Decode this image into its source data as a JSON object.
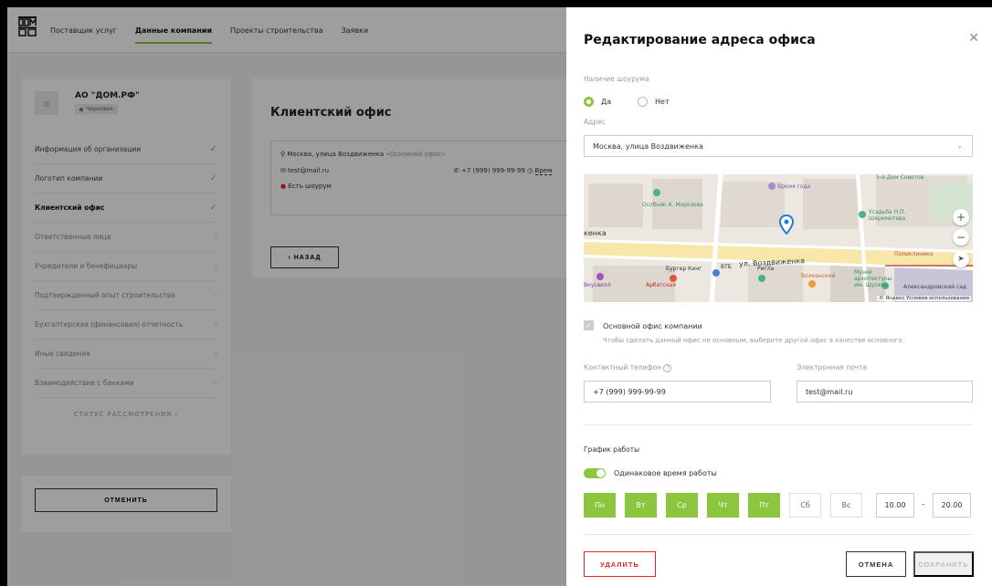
{
  "header": {
    "nav": [
      "Поставщик услуг",
      "Данные компании",
      "Проекты строительства",
      "Заявки"
    ],
    "active_index": 1
  },
  "company": {
    "name": "АО \"ДОМ.РФ\"",
    "status": "Черновик"
  },
  "sidebar": {
    "items": [
      {
        "label": "Информация об организации",
        "state": "done"
      },
      {
        "label": "Логотип компании",
        "state": "done"
      },
      {
        "label": "Клиентский офис",
        "state": "current"
      },
      {
        "label": "Ответственные лица",
        "state": "todo"
      },
      {
        "label": "Учредители и бенефициары",
        "state": "todo"
      },
      {
        "label": "Подтвержденный опыт строительства",
        "state": "todo"
      },
      {
        "label": "Бухгалтерская (финансовая) отчетность",
        "state": "todo"
      },
      {
        "label": "Иные сведения",
        "state": "todo"
      },
      {
        "label": "Взаимодействие с банками",
        "state": "todo"
      }
    ],
    "status_label": "СТАТУС РАССМОТРЕНИЯ",
    "cancel_label": "ОТМЕНИТЬ"
  },
  "office": {
    "title": "Клиентский офис",
    "address": "Москва, улица Воздвиженка",
    "main_tag": "«Основной офис»",
    "email": "test@mail.ru",
    "phone": "+7 (999) 999-99-99",
    "time_label": "Врем",
    "showroom": "Есть шоурум",
    "back_label": "НАЗАД"
  },
  "panel": {
    "title": "Редактирование адреса офиса",
    "showroom_label": "Наличие шоурума",
    "yes": "Да",
    "no": "Нет",
    "address_label": "Адрес",
    "address_value": "Москва, улица Воздвиженка",
    "map": {
      "street": "ул. Воздвиженка",
      "street_left": "кенка",
      "labels": [
        "Особняк А. Морозова",
        "Время года",
        "5-й Дом Советов",
        "Усадьба Н.П. Шереметева",
        "Поликлиника",
        "ВТБ",
        "Бургер Кинг",
        "Ригла",
        "Волконский",
        "Арбатская",
        "Музей архитектуры им. Щусева",
        "Александровский сад",
        "Вкусвилл"
      ],
      "copyright": "© Яндекс Условия использования"
    },
    "main_office_label": "Основной офис компании",
    "main_office_hint": "Чтобы сделать данный офис не основным, выберите другой офис в качестве основного",
    "phone_label": "Контактный телефон",
    "phone_value": "+7 (999) 999-99-99",
    "email_label": "Электронная почта",
    "email_value": "test@mail.ru",
    "schedule_label": "График работы",
    "same_time_label": "Одинаковое время работы",
    "days": [
      {
        "label": "Пн",
        "on": true
      },
      {
        "label": "Вт",
        "on": true
      },
      {
        "label": "Ср",
        "on": true
      },
      {
        "label": "Чт",
        "on": true
      },
      {
        "label": "Пт",
        "on": true
      },
      {
        "label": "Сб",
        "on": false
      },
      {
        "label": "Вс",
        "on": false
      }
    ],
    "time_from": "10.00",
    "time_to": "20.00",
    "delete_label": "УДАЛИТЬ",
    "cancel_label": "ОТМЕНА",
    "save_label": "СОХРАНИТЬ"
  },
  "colors": {
    "accent": "#8cc63f",
    "danger": "#e02424"
  }
}
